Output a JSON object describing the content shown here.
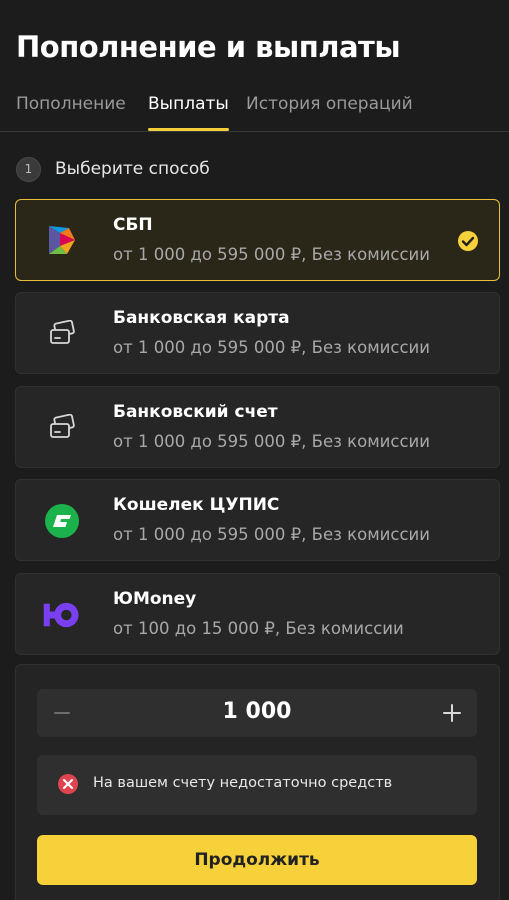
{
  "page": {
    "title": "Пополнение и выплаты"
  },
  "tabs": [
    {
      "label": "Пополнение"
    },
    {
      "label": "Выплаты",
      "active": true
    },
    {
      "label": "История операций"
    }
  ],
  "step": {
    "number": "1",
    "label": "Выберите способ"
  },
  "methods": [
    {
      "name": "СБП",
      "description": "от 1 000 до 595 000 ₽, Без комиссии",
      "icon": "sbp-logo-icon",
      "selected": true
    },
    {
      "name": "Банковская карта",
      "description": "от 1 000 до 595 000 ₽, Без комиссии",
      "icon": "bank-card-icon"
    },
    {
      "name": "Банковский счет",
      "description": "от 1 000 до 595 000 ₽, Без комиссии",
      "icon": "bank-account-icon"
    },
    {
      "name": "Кошелек ЦУПИС",
      "description": "от 1 000 до 595 000 ₽, Без комиссии",
      "icon": "cupis-wallet-icon"
    },
    {
      "name": "ЮMoney",
      "description": "от 100 до 15 000 ₽, Без комиссии",
      "icon": "yumoney-logo-icon"
    }
  ],
  "amount": {
    "value": "1 000"
  },
  "error": {
    "message": "На вашем счету недостаточно средств"
  },
  "continue_button": {
    "label": "Продолжить"
  },
  "colors": {
    "accent": "#f6d13a",
    "background": "#1c1c1c",
    "card": "#262626",
    "error": "#e0454f",
    "cupis": "#1bb24b",
    "yumoney": "#7b3ff2"
  }
}
